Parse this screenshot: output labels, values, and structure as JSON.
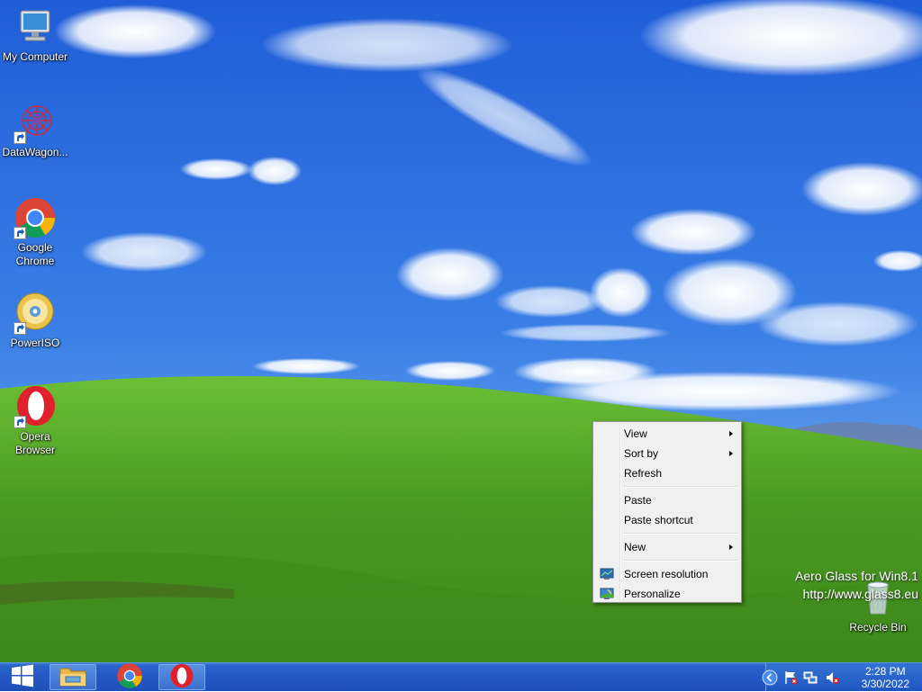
{
  "desktop": {
    "icons": [
      {
        "label": "My Computer"
      },
      {
        "label": "DataWagon..."
      },
      {
        "label_line1": "Google",
        "label_line2": "Chrome"
      },
      {
        "label": "PowerISO"
      },
      {
        "label_line1": "Opera",
        "label_line2": "Browser"
      },
      {
        "label": "Recycle Bin"
      }
    ]
  },
  "watermark": {
    "line1": "Aero Glass for Win8.1",
    "line2": "http://www.glass8.eu"
  },
  "context_menu": {
    "items": [
      {
        "label": "View",
        "submenu": true
      },
      {
        "label": "Sort by",
        "submenu": true
      },
      {
        "label": "Refresh"
      },
      {
        "label": "Paste"
      },
      {
        "label": "Paste shortcut"
      },
      {
        "label": "New",
        "submenu": true
      },
      {
        "label": "Screen resolution",
        "icon": "display-icon"
      },
      {
        "label": "Personalize",
        "icon": "personalize-icon"
      }
    ]
  },
  "taskbar": {
    "pinned": [
      {
        "icon": "file-explorer-icon"
      },
      {
        "icon": "chrome-icon"
      },
      {
        "icon": "opera-icon"
      }
    ],
    "tray_icons": [
      "show-hidden-icons-icon",
      "action-center-flag-icon",
      "network-icon",
      "volume-muted-icon"
    ],
    "clock": {
      "time": "2:28 PM",
      "date": "3/30/2022"
    }
  },
  "colors": {
    "sky": "#2f6fe0",
    "hill": "#5aa52a",
    "taskbar": "#2458c4",
    "menu_bg": "#f0f0f0"
  }
}
